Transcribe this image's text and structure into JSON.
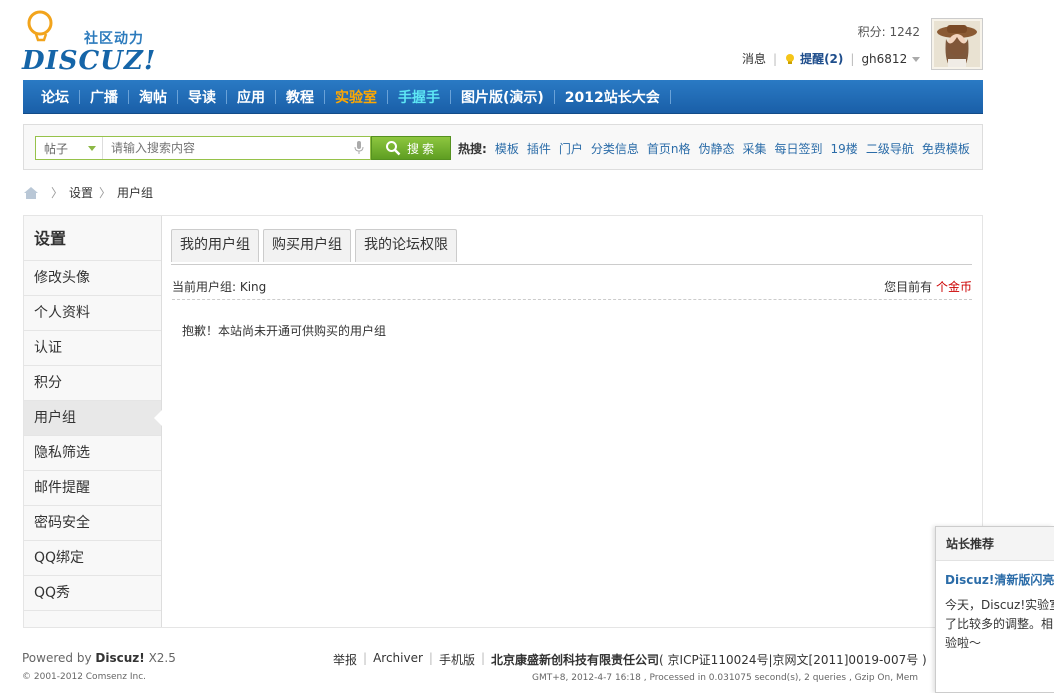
{
  "header": {
    "logo_tagline": "社区动力",
    "logo_brand": "DISCUZ!",
    "points": "积分: 1242",
    "messages": "消息",
    "remind": "提醒(2)",
    "username": "gh6812"
  },
  "nav": {
    "items": [
      "论坛",
      "广播",
      "淘帖",
      "导读",
      "应用",
      "教程",
      "实验室",
      "手握手",
      "图片版(演示)",
      "2012站长大会"
    ]
  },
  "search": {
    "type": "帖子",
    "placeholder": "请输入搜索内容",
    "button": "搜索",
    "hot_label": "热搜:",
    "hot_links": [
      "模板",
      "插件",
      "门户",
      "分类信息",
      "首页n格",
      "伪静态",
      "采集",
      "每日签到",
      "19楼",
      "二级导航",
      "免费模板"
    ]
  },
  "breadcrumb": {
    "items": [
      "设置",
      "用户组"
    ]
  },
  "sidebar": {
    "title": "设置",
    "items": [
      "修改头像",
      "个人资料",
      "认证",
      "积分",
      "用户组",
      "隐私筛选",
      "邮件提醒",
      "密码安全",
      "QQ绑定",
      "QQ秀"
    ],
    "active_index": 4
  },
  "content": {
    "tabs": [
      "我的用户组",
      "购买用户组",
      "我的论坛权限"
    ],
    "current_group_label": "当前用户组: King",
    "balance_label": "您目前有",
    "balance_value": "个金币",
    "notice": "抱歉！本站尚未开通可供购买的用户组"
  },
  "footer": {
    "powered_prefix": "Powered by",
    "powered_brand": "Discuz!",
    "powered_version": "X2.5",
    "copyright": "© 2001-2012 Comsenz Inc.",
    "links": [
      "举报",
      "Archiver",
      "手机版"
    ],
    "company": "北京康盛新创科技有限责任公司",
    "icp": "( 京ICP证110024号|京网文[2011]0019-007号 )",
    "stats": "GMT+8, 2012-4-7 16:18 , Processed in 0.031075 second(s), 2 queries , Gzip On, Mem"
  },
  "recommend": {
    "header": "站长推荐",
    "title": "Discuz!清新版闪亮",
    "body": "今天，Discuz!实验室新版”，不仅是风格有了比较多的调整。相的感觉。不多说，具体验啦～"
  },
  "colors": {
    "nav_bg": "#1f68b0",
    "lab": "#ffa800",
    "hand": "#5de6f4",
    "search_btn": "#6aab2c",
    "coin": "#cc0000",
    "link": "#2b6ca8"
  }
}
